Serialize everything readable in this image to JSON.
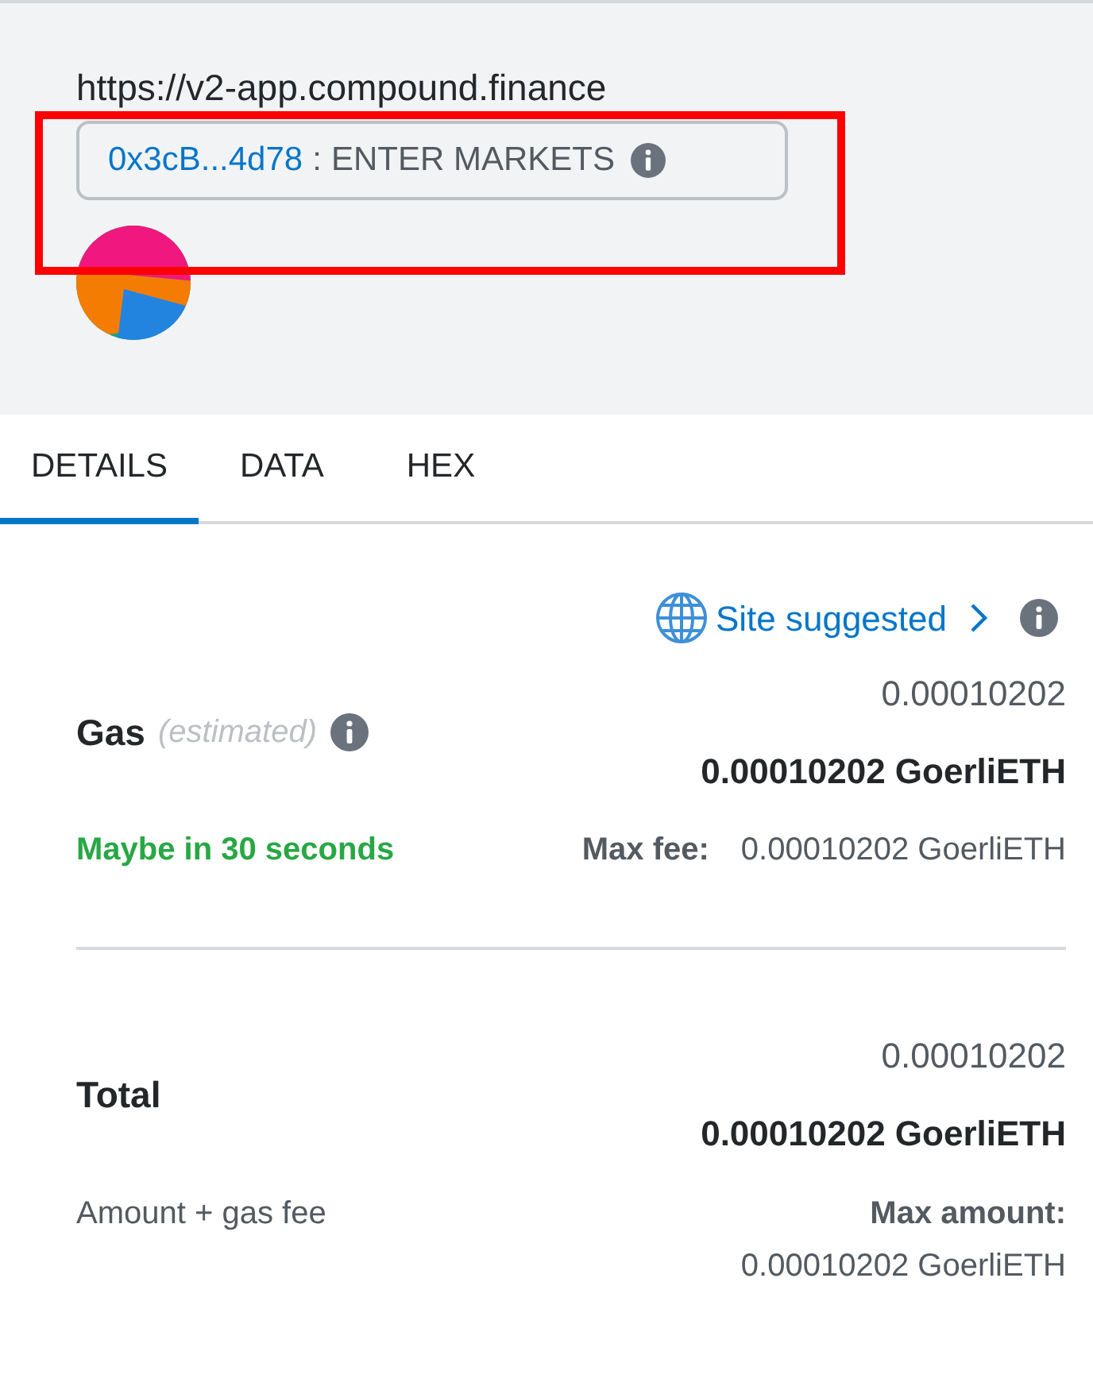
{
  "origin": "https://v2-app.compound.finance",
  "highlight": {
    "kind": "frame"
  },
  "method": {
    "address": "0x3cB...4d78",
    "separator": ":",
    "name": "ENTER MARKETS"
  },
  "tabs": [
    {
      "label": "DETAILS",
      "selected": true
    },
    {
      "label": "DATA",
      "selected": false
    },
    {
      "label": "HEX",
      "selected": false
    }
  ],
  "site_suggested": {
    "label": "Site suggested"
  },
  "gas": {
    "label": "Gas",
    "hint": "(estimated)",
    "value": "0.00010202",
    "value_bold": "0.00010202 GoerliETH",
    "timing": "Maybe in 30 seconds",
    "max_label": "Max fee:",
    "max_value": "0.00010202 GoerliETH"
  },
  "total": {
    "label": "Total",
    "value": "0.00010202",
    "value_bold": "0.00010202 GoerliETH",
    "sub_label": "Amount + gas fee",
    "max_label": "Max amount:",
    "max_value": "0.00010202 GoerliETH"
  }
}
